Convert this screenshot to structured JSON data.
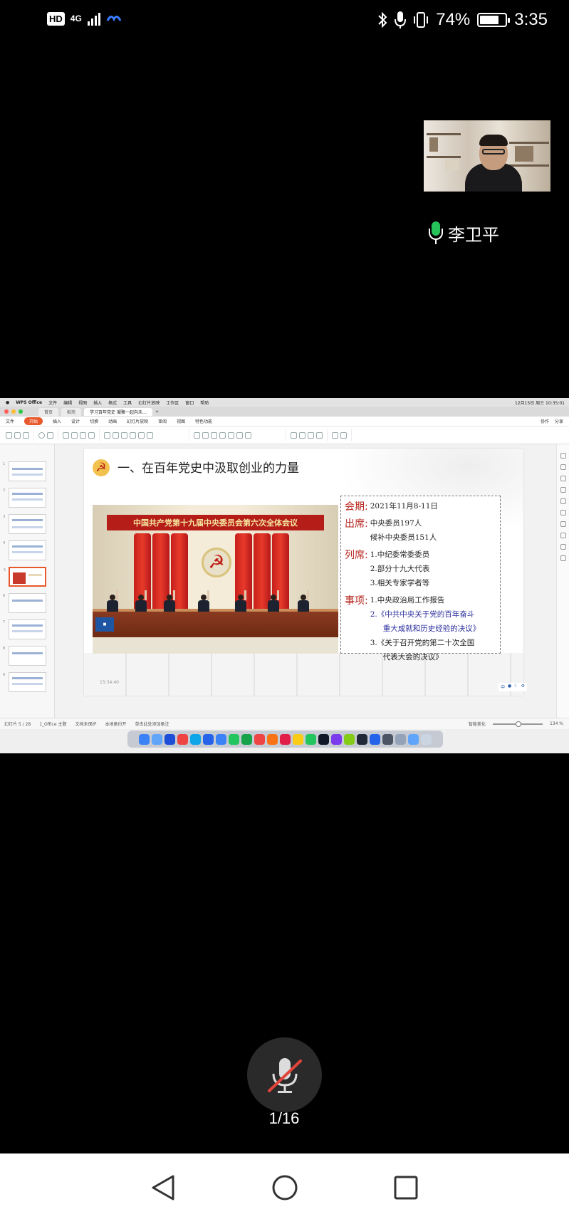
{
  "status_bar": {
    "hd": "HD",
    "network": "4G",
    "battery_pct": "74%",
    "time": "3:35"
  },
  "participant": {
    "name": "李卫平"
  },
  "shared_screen": {
    "mac_menu": [
      "WPS Office",
      "文件",
      "编辑",
      "视图",
      "插入",
      "格式",
      "工具",
      "幻灯片放映",
      "工作区",
      "窗口",
      "帮助"
    ],
    "mac_clock": "12月15日 周三 10:35:01",
    "tabs": [
      {
        "label": "首页",
        "active": false
      },
      {
        "label": "稻壳",
        "active": false
      },
      {
        "label": "学习百年党史 凝聚一起向未…",
        "active": true
      }
    ],
    "ribbon_tabs": [
      "文件",
      "开始",
      "插入",
      "设计",
      "切换",
      "动画",
      "幻灯片放映",
      "审阅",
      "视图",
      "特色功能"
    ],
    "ribbon_right": [
      "协作",
      "分享"
    ],
    "status": {
      "slide_counter": "幻灯片 5 / 28",
      "theme": "1_Office 主题",
      "save_state": "文档未保护",
      "backup": "本地备份开",
      "smart_beautify": "智能美化",
      "zoom": "134 %"
    },
    "notes_placeholder": "单击此处添加备注"
  },
  "slide": {
    "title": "一、在百年党史中汲取创业的力量",
    "banner": "中国共产党第十九届中央委员会第六次全体会议",
    "photo_timestamp": "15:34:40",
    "info": {
      "meeting_label": "会期:",
      "meeting_date": "2021年11月8-11日",
      "attend_label": "出席:",
      "attend_lines": [
        "中央委员197人",
        "候补中央委员151人"
      ],
      "observer_label": "列席:",
      "observer_lines": [
        "1.中纪委常委委员",
        "2.部分十九大代表",
        "3.相关专家学者等"
      ],
      "agenda_label": "事项:",
      "agenda_1": "1.中央政治局工作报告",
      "agenda_2a": "2.《中共中央关于党的百年奋斗",
      "agenda_2b": "重大成就和历史经验的决议》",
      "agenda_3a": "3.《关于召开党的第二十次全国",
      "agenda_3b": "代表大会的决议》"
    }
  },
  "controls": {
    "page_indicator": "1/16"
  },
  "colors": {
    "accent_red": "#b7261e",
    "mic_green": "#25c35a",
    "wps_orange": "#e8582b"
  }
}
